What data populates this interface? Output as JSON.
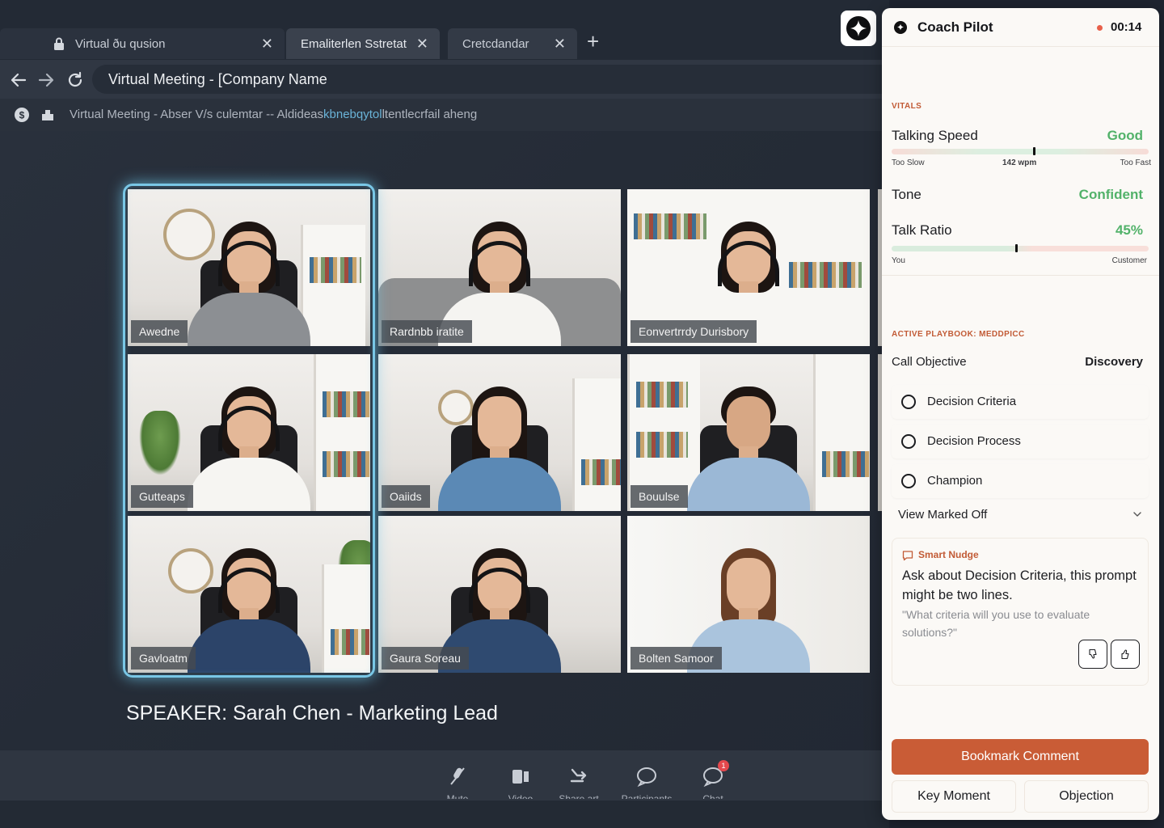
{
  "browser": {
    "tabs": [
      {
        "label": "Virtual ðu qusion"
      },
      {
        "label": "Emaliterlen Sstretat"
      },
      {
        "label": "Cretcdandar"
      }
    ],
    "url": "Virtual Meeting - [Company Name",
    "bookmarks": {
      "text_a": "Virtual Meeting - Abser V/s culemtar -- Aldideas",
      "text_accent": "kbnebqytol",
      "text_b": "ltentlecrfail aheng"
    }
  },
  "meeting": {
    "participants": [
      {
        "name": "Awedne"
      },
      {
        "name": "Rardnbb iratite"
      },
      {
        "name": "Eonvertrrdy Durisbory"
      },
      {
        "name": "Gutteaps"
      },
      {
        "name": "Oaiids"
      },
      {
        "name": "Bouulse"
      },
      {
        "name": "Gavloatm"
      },
      {
        "name": "Gaura Soreau"
      },
      {
        "name": "Bolten Samoor"
      }
    ],
    "speaker": "SPEAKER: Sarah Chen - Marketing Lead"
  },
  "controls": [
    {
      "label": "Mute",
      "icon": "microphone-icon"
    },
    {
      "label": "Video",
      "icon": "video-icon"
    },
    {
      "label": "Share art",
      "icon": "share-icon"
    },
    {
      "label": "Participants",
      "icon": "participants-icon"
    },
    {
      "label": "Chat",
      "icon": "chat-icon",
      "badge": "1"
    }
  ],
  "panel": {
    "title": "Coach Pilot",
    "timer": "00:14",
    "vitals": {
      "section": "VITALS",
      "talking_speed": {
        "label": "Talking Speed",
        "value": "Good",
        "wpm": "142 wpm",
        "min": "Too Slow",
        "max": "Too Fast",
        "level": 0.55
      },
      "tone": {
        "label": "Tone",
        "value": "Confident"
      },
      "talk_ratio": {
        "label": "Talk Ratio",
        "value": "45%",
        "min": "You",
        "max": "Customer",
        "level": 0.48
      }
    },
    "playbook": {
      "section": "ACTIVE PLAYBOOK: MEDDPICC",
      "objective_label": "Call Objective",
      "objective_value": "Discovery",
      "items": [
        {
          "label": "Decision Criteria"
        },
        {
          "label": "Decision Process"
        },
        {
          "label": "Champion"
        }
      ],
      "view_marked": "View Marked Off"
    },
    "nudge": {
      "title": "Smart Nudge",
      "message": "Ask about Decision Criteria, this prompt might be two lines.",
      "quote": "\"What criteria will you use to evaluate solutions?\""
    },
    "actions": {
      "primary": "Bookmark Comment",
      "key_moment": "Key Moment",
      "objection": "Objection"
    }
  },
  "colors": {
    "accent": "#c95c36",
    "good": "#52b26a",
    "highlight": "#79c7e6"
  }
}
